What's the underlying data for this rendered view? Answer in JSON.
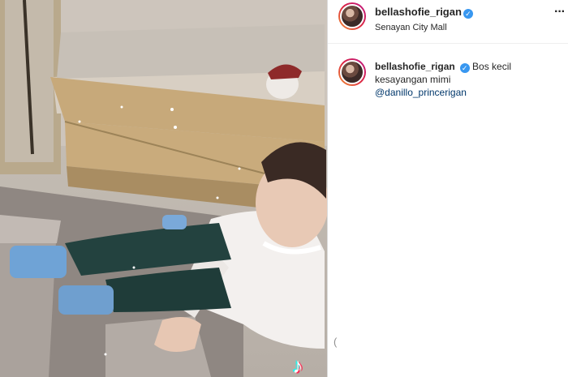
{
  "post": {
    "username": "bellashofie_rigan",
    "verified_icon": "verified-badge-icon",
    "location": "Senayan City Mall",
    "more_icon": "more-options-icon",
    "more_glyph": "···"
  },
  "caption": {
    "username": "bellashofie_rigan",
    "text": "Bos kecil kesayangan mimi",
    "mention": "@danillo_princerigan"
  },
  "media": {
    "watermark_icon": "tiktok-logo-icon",
    "watermark_glyph": "♪"
  },
  "panel_fragment": "(",
  "colors": {
    "accent_link": "#00376b",
    "verified": "#3897f0",
    "divider": "#dbdbdb"
  }
}
